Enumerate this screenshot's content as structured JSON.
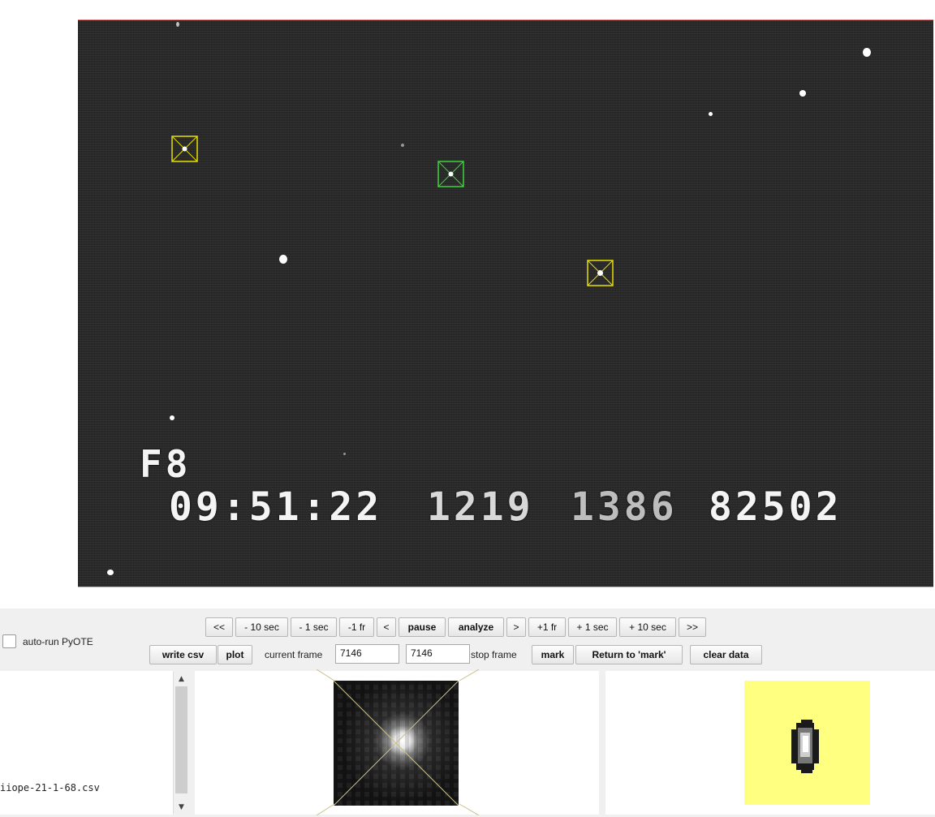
{
  "video": {
    "osd_field": "F8",
    "osd_time": "09:51:22",
    "osd_ms1": "1219",
    "osd_ms2": "1386",
    "osd_count": "82502"
  },
  "controls": {
    "autorun_label": "auto-run PyOTE",
    "autorun_checked": false,
    "nav_buttons": [
      "<<",
      "- 10 sec",
      "- 1 sec",
      "-1 fr",
      "<",
      "pause",
      "analyze",
      ">",
      "+1 fr",
      "+ 1 sec",
      "+ 10 sec",
      ">>"
    ],
    "write_csv": "write csv",
    "plot": "plot",
    "current_frame_label": "current frame",
    "current_frame_value": "7146",
    "stop_frame_value": "7146",
    "stop_frame_label": "stop frame",
    "mark": "mark",
    "return_to_mark": "Return to 'mark'",
    "clear_data": "clear data"
  },
  "file_list": {
    "items": [
      "iiope-21-1-68.csv"
    ]
  },
  "colors": {
    "marker_target": "#39d639",
    "marker_ref": "#e6e000",
    "mask_background": "#ffff80"
  },
  "icons": {
    "scroll_up": "triangle-up-icon",
    "scroll_down": "triangle-down-icon"
  }
}
